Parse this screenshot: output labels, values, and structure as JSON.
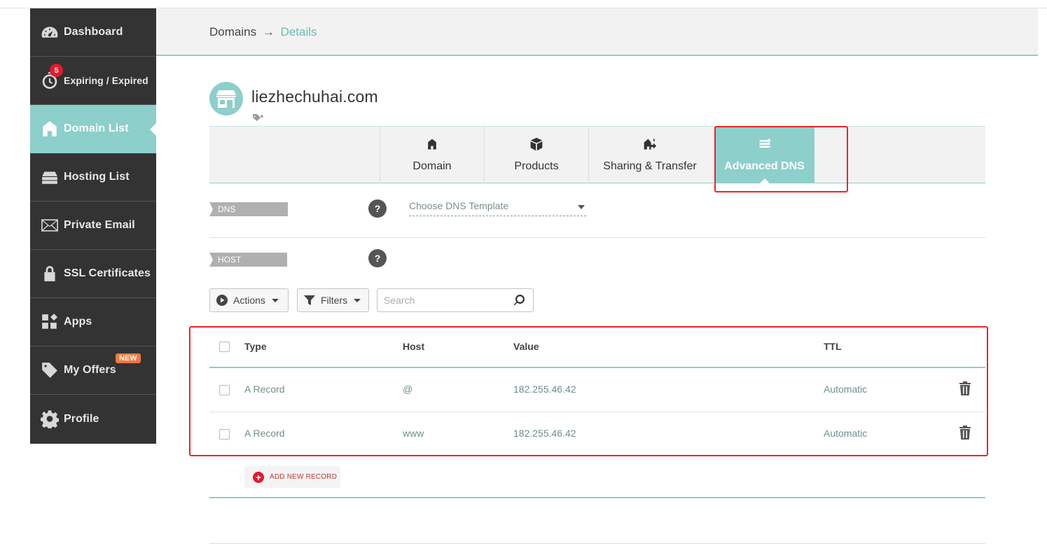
{
  "sidebar": {
    "items": [
      {
        "label": "Dashboard",
        "icon": "speedometer-icon"
      },
      {
        "label": "Expiring / Expired",
        "icon": "stopwatch-icon",
        "badge": "5"
      },
      {
        "label": "Domain List",
        "icon": "home-icon",
        "active": true
      },
      {
        "label": "Hosting List",
        "icon": "server-icon"
      },
      {
        "label": "Private Email",
        "icon": "envelope-icon"
      },
      {
        "label": "SSL Certificates",
        "icon": "lock-icon"
      },
      {
        "label": "Apps",
        "icon": "apps-grid-icon"
      },
      {
        "label": "My Offers",
        "icon": "tag-icon",
        "badge": "NEW"
      },
      {
        "label": "Profile",
        "icon": "gear-icon"
      }
    ]
  },
  "header": {
    "breadcrumb_root": "Domains",
    "breadcrumb_sep": "→",
    "breadcrumb_current": "Details"
  },
  "domain": {
    "name": "liezhechuhai.com",
    "avatar_icon": "storefront-icon"
  },
  "tabs": [
    {
      "label": "Domain",
      "icon": "home-icon"
    },
    {
      "label": "Products",
      "icon": "box-icon"
    },
    {
      "label": "Sharing & Transfer",
      "icon": "share-house-icon"
    },
    {
      "label": "Advanced DNS",
      "icon": "dns-server-icon",
      "active": true
    }
  ],
  "dns_templates": {
    "label": "DNS TEMPLATES",
    "help": "?",
    "select_value": "Choose DNS Template"
  },
  "host_records": {
    "label": "HOST RECORDS",
    "help": "?"
  },
  "toolbar": {
    "actions_label": "Actions",
    "filters_label": "Filters",
    "search_placeholder": "Search"
  },
  "table": {
    "columns": [
      "Type",
      "Host",
      "Value",
      "TTL"
    ],
    "rows": [
      {
        "type": "A Record",
        "host": "@",
        "value": "182.255.46.42",
        "ttl": "Automatic"
      },
      {
        "type": "A Record",
        "host": "www",
        "value": "182.255.46.42",
        "ttl": "Automatic"
      }
    ]
  },
  "add_record_label": "ADD NEW RECORD",
  "colors": {
    "accent": "#8ccfcb",
    "sidebar_bg": "#333333",
    "annotation": "#e8262b",
    "badge_red": "#e8172c",
    "badge_orange": "#f2783b"
  }
}
